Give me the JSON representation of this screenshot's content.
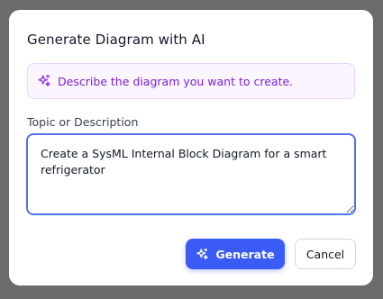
{
  "dialog": {
    "title": "Generate Diagram with AI",
    "banner": {
      "icon": "sparkles-icon",
      "text": "Describe the diagram you want to create."
    },
    "field": {
      "label": "Topic or Description",
      "value": "Create a SysML Internal Block Diagram for a smart refrigerator"
    },
    "buttons": {
      "generate_label": "Generate",
      "generate_icon": "sparkles-icon",
      "cancel_label": "Cancel"
    }
  },
  "colors": {
    "overlay": "#6b6b6b",
    "accent": "#3b5bf5",
    "banner_bg": "#faf5ff",
    "banner_text": "#7e22ce",
    "focus_border": "#4f74e8"
  }
}
